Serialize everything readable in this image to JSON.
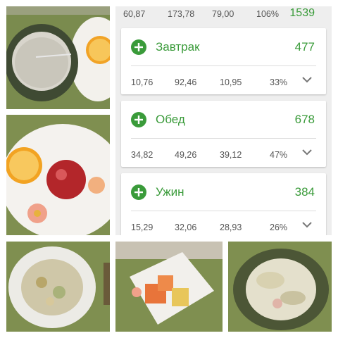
{
  "colors": {
    "accent": "#3a9b3a",
    "text_muted": "#555555",
    "background": "#eeeeee"
  },
  "summary": {
    "v1": "60,87",
    "v2": "173,78",
    "v3": "79,00",
    "percent": "106%",
    "kcal": "1539"
  },
  "meals": [
    {
      "name": "Завтрак",
      "kcal": "477",
      "v1": "10,76",
      "v2": "92,46",
      "v3": "10,95",
      "percent": "33%"
    },
    {
      "name": "Обед",
      "kcal": "678",
      "v1": "34,82",
      "v2": "49,26",
      "v3": "39,12",
      "percent": "47%"
    },
    {
      "name": "Ужин",
      "kcal": "384",
      "v1": "15,29",
      "v2": "32,06",
      "v3": "28,93",
      "percent": "26%"
    }
  ],
  "icons": {
    "add": "plus-circle-icon",
    "expand": "chevron-down-icon"
  }
}
